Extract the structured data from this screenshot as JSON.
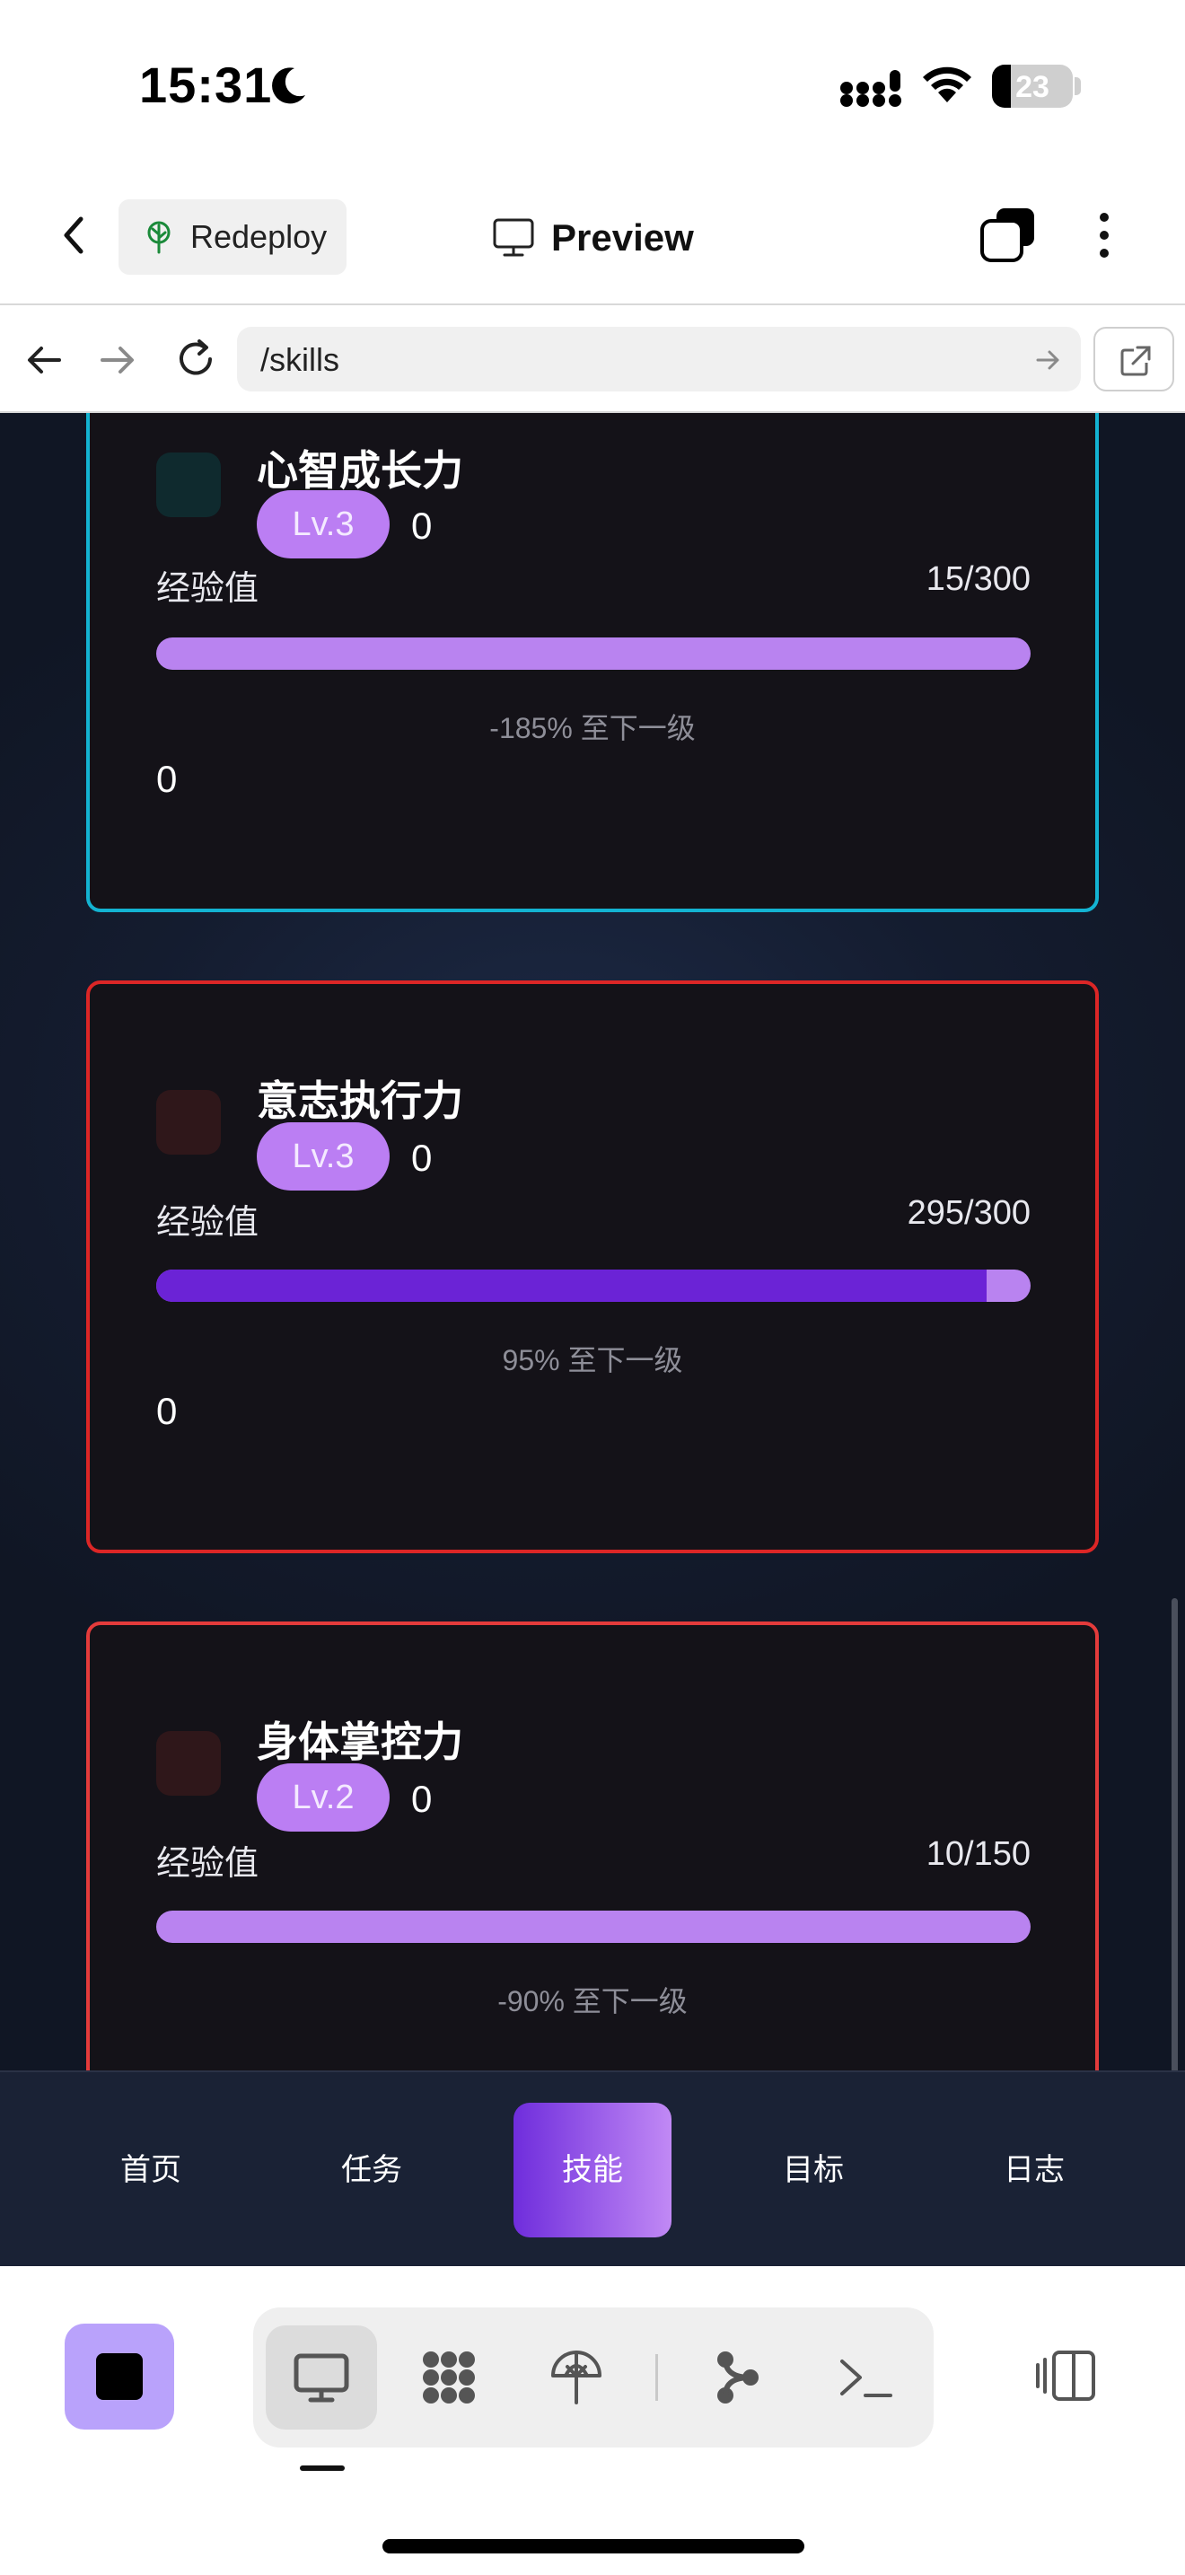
{
  "status_bar": {
    "time": "15:31",
    "battery": "23"
  },
  "header": {
    "redeploy_label": "Redeploy",
    "title": "Preview"
  },
  "url_bar": {
    "url": "/skills"
  },
  "skills": [
    {
      "name": "心智成长力",
      "level": "Lv.3",
      "level_number": "0",
      "exp_label": "经验值",
      "exp_value": "15/300",
      "progress_fraction": 0.05,
      "next_level_text": "-185% 至下一级",
      "points": "0",
      "border_color": "#13b3d2",
      "icon_color": "#0f2a2e"
    },
    {
      "name": "意志执行力",
      "level": "Lv.3",
      "level_number": "0",
      "exp_label": "经验值",
      "exp_value": "295/300",
      "progress_fraction": 0.95,
      "next_level_text": "95% 至下一级",
      "points": "0",
      "border_color": "#dc2626",
      "icon_color": "#2f171a"
    },
    {
      "name": "身体掌控力",
      "level": "Lv.2",
      "level_number": "0",
      "exp_label": "经验值",
      "exp_value": "10/150",
      "progress_fraction": 0.07,
      "next_level_text": "-90% 至下一级",
      "points": "0",
      "border_color": "#e43b3b",
      "icon_color": "#2f171a"
    }
  ],
  "app_nav": {
    "items": [
      {
        "label": "首页",
        "active": false
      },
      {
        "label": "任务",
        "active": false
      },
      {
        "label": "技能",
        "active": true
      },
      {
        "label": "目标",
        "active": false
      },
      {
        "label": "日志",
        "active": false
      }
    ]
  },
  "toolbar": {
    "tools": [
      "desktop-preview-icon",
      "apps-grid-icon",
      "deploy-icon",
      "branch-icon",
      "terminal-icon"
    ],
    "active_tool": "desktop-preview-icon"
  },
  "colors": {
    "accent": "#b983f0",
    "accent_dark": "#6b23d6",
    "nav_bg": "#1a2235"
  }
}
